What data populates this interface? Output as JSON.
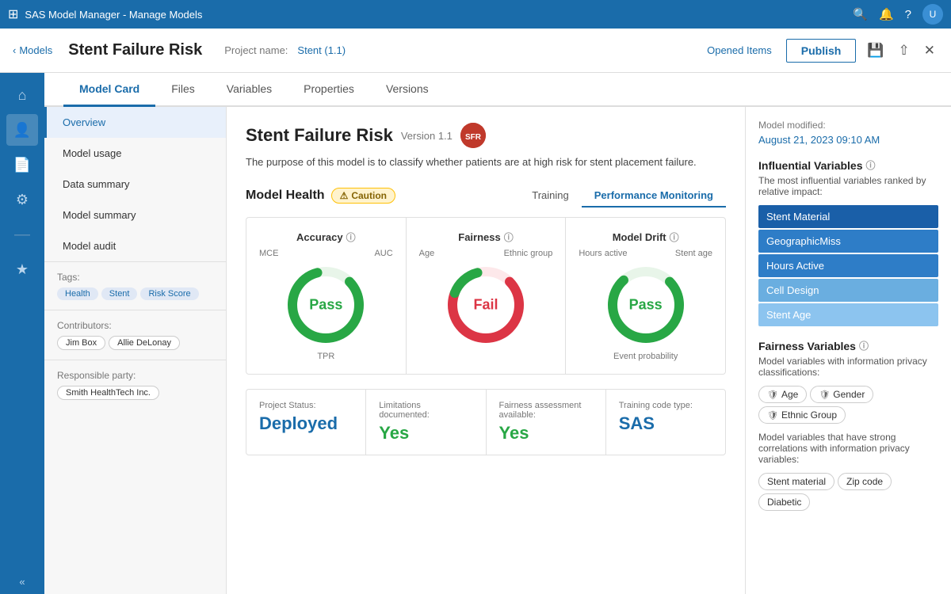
{
  "topbar": {
    "title": "SAS Model Manager - Manage Models",
    "icons": [
      "search",
      "bell",
      "help",
      "user"
    ]
  },
  "subheader": {
    "breadcrumb": "Models",
    "page_title": "Stent Failure Risk",
    "project_label": "Project name:",
    "project_link": "Stent (1.1)",
    "publish_label": "Publish",
    "opened_items_label": "Opened Items"
  },
  "tabs": [
    {
      "label": "Model Card",
      "active": true
    },
    {
      "label": "Files",
      "active": false
    },
    {
      "label": "Variables",
      "active": false
    },
    {
      "label": "Properties",
      "active": false
    },
    {
      "label": "Versions",
      "active": false
    }
  ],
  "left_panel": {
    "nav_items": [
      {
        "label": "Overview",
        "active": true
      },
      {
        "label": "Model usage",
        "active": false
      },
      {
        "label": "Data summary",
        "active": false
      },
      {
        "label": "Model summary",
        "active": false
      },
      {
        "label": "Model audit",
        "active": false
      }
    ],
    "tags_label": "Tags:",
    "tags": [
      "Health",
      "Stent",
      "Risk Score"
    ],
    "contributors_label": "Contributors:",
    "contributors": [
      "Jim Box",
      "Allie DeLonay"
    ],
    "responsible_label": "Responsible party:",
    "responsible": [
      "Smith HealthTech Inc."
    ]
  },
  "model": {
    "title": "Stent Failure Risk",
    "version": "Version 1.1",
    "description": "The purpose of this model is to classify whether patients are at high risk for stent placement failure.",
    "icon_text": "SFR"
  },
  "health": {
    "title": "Model Health",
    "caution_label": "Caution",
    "tabs": [
      {
        "label": "Training",
        "active": false
      },
      {
        "label": "Performance Monitoring",
        "active": true
      }
    ],
    "gauges": [
      {
        "label": "Accuracy",
        "left_sub": "MCE",
        "right_sub": "AUC",
        "bottom_sub": "TPR",
        "result": "Pass",
        "result_type": "pass",
        "arc_color": "#28a745",
        "bg_color": "#d4edda"
      },
      {
        "label": "Fairness",
        "left_sub": "Age",
        "right_sub": "Ethnic group",
        "bottom_sub": "",
        "result": "Fail",
        "result_type": "fail",
        "arc_color": "#dc3545",
        "bg_color": "#f8d7da"
      },
      {
        "label": "Model Drift",
        "left_sub": "Hours active",
        "right_sub": "Stent age",
        "bottom_sub": "Event probability",
        "result": "Pass",
        "result_type": "pass",
        "arc_color": "#28a745",
        "bg_color": "#d4edda"
      }
    ]
  },
  "status_cards": [
    {
      "label": "Project Status:",
      "value": "Deployed",
      "type": "deployed"
    },
    {
      "label": "Limitations documented:",
      "value": "Yes",
      "type": "yes"
    },
    {
      "label": "Fairness assessment available:",
      "value": "Yes",
      "type": "yes"
    },
    {
      "label": "Training code type:",
      "value": "SAS",
      "type": "sas"
    }
  ],
  "right_panel": {
    "modified_label": "Model modified:",
    "modified_date": "August 21, 2023 09:10 AM",
    "influential_title": "Influential Variables",
    "influential_desc": "The most influential variables ranked by relative impact:",
    "influential_items": [
      {
        "label": "Stent Material",
        "shade": "dark"
      },
      {
        "label": "GeographicMiss",
        "shade": "medium"
      },
      {
        "label": "Hours Active",
        "shade": "medium"
      },
      {
        "label": "Cell Design",
        "shade": "light"
      },
      {
        "label": "Stent Age",
        "shade": "lighter"
      }
    ],
    "fairness_title": "Fairness Variables",
    "fairness_desc": "Model variables with information privacy classifications:",
    "fairness_chips": [
      {
        "label": "Age",
        "icon": "shield"
      },
      {
        "label": "Gender",
        "icon": "shield"
      },
      {
        "label": "Ethnic Group",
        "icon": "shield"
      }
    ],
    "privacy_desc": "Model variables that have strong correlations with information privacy variables:",
    "privacy_chips": [
      {
        "label": "Stent material"
      },
      {
        "label": "Zip code"
      },
      {
        "label": "Diabetic"
      }
    ]
  }
}
